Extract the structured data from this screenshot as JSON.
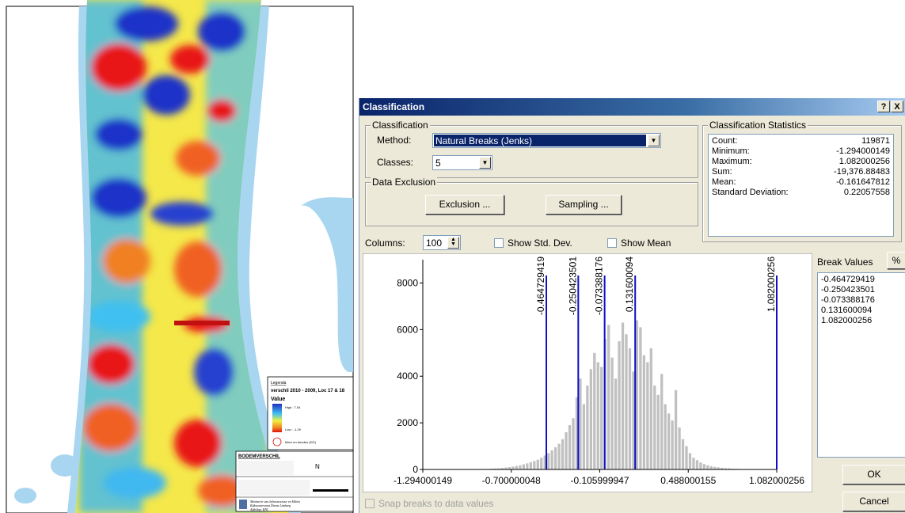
{
  "map": {
    "legend_title": "Legenda",
    "legend_layer": "verschil 2010 - 2009, Loc 17 & 18",
    "legend_value": "Value",
    "legend_high": "High : 7.04",
    "legend_low": "Low : -1.29",
    "legend_extra": "Meer en benden (DG)",
    "titleblock_heading": "BODEMVERSCHIL",
    "ministry": "Ministerie van Infrastructuur en Milieu",
    "ministry2": "Rijkswaterstaat Dienst Limburg",
    "ministry3": "Afdeling: RNI",
    "north": "N"
  },
  "dialog": {
    "title": "Classification",
    "help_btn": "?",
    "close_btn": "X",
    "classification_group": "Classification",
    "method_label": "Method:",
    "method_value": "Natural Breaks (Jenks)",
    "classes_label": "Classes:",
    "classes_value": "5",
    "exclusion_group": "Data Exclusion",
    "exclusion_btn": "Exclusion ...",
    "sampling_btn": "Sampling ...",
    "stats_group": "Classification Statistics",
    "stats": [
      {
        "label": "Count:",
        "value": "119871"
      },
      {
        "label": "Minimum:",
        "value": "-1.294000149"
      },
      {
        "label": "Maximum:",
        "value": "1.082000256"
      },
      {
        "label": "Sum:",
        "value": "-19,376.88483"
      },
      {
        "label": "Mean:",
        "value": "-0.161647812"
      },
      {
        "label": "Standard Deviation:",
        "value": "0.22057558"
      }
    ],
    "columns_label": "Columns:",
    "columns_value": "100",
    "show_std_dev": "Show Std. Dev.",
    "show_mean": "Show Mean",
    "break_values_label": "Break Values",
    "percent_btn": "%",
    "break_values": [
      "-0.464729419",
      "-0.250423501",
      "-0.073388176",
      "0.131600094",
      "1.082000256"
    ],
    "ok_btn": "OK",
    "cancel_btn": "Cancel",
    "snap_breaks": "Snap breaks to data values"
  },
  "chart_data": {
    "type": "bar",
    "x_ticks": [
      -1.294000149,
      -0.700000048,
      -0.105999947,
      0.488000155,
      1.082000256
    ],
    "x_tick_labels": [
      "-1.294000149",
      "-0.700000048",
      "-0.105999947",
      "0.488000155",
      "1.082000256"
    ],
    "y_ticks": [
      0,
      2000,
      4000,
      6000,
      8000
    ],
    "xlim": [
      -1.294000149,
      1.082000256
    ],
    "ylim": [
      0,
      9000
    ],
    "breaks": [
      -0.464729419,
      -0.250423501,
      -0.073388176,
      0.131600094,
      1.082000256
    ],
    "break_labels": [
      "-0.464729419",
      "-0.250423501",
      "-0.073388176",
      "0.131600094",
      "1.082000256"
    ],
    "bin_count": 100,
    "values": [
      0,
      0,
      0,
      0,
      0,
      0,
      0,
      0,
      0,
      0,
      0,
      0,
      0,
      0,
      0,
      5,
      10,
      15,
      20,
      30,
      40,
      50,
      60,
      80,
      100,
      120,
      150,
      180,
      220,
      260,
      310,
      360,
      420,
      500,
      600,
      700,
      820,
      950,
      1100,
      1300,
      1600,
      1900,
      2200,
      3100,
      3900,
      2800,
      3600,
      4300,
      5000,
      4600,
      4400,
      5600,
      6200,
      4800,
      3900,
      5500,
      6300,
      5800,
      5200,
      4200,
      6400,
      6100,
      4900,
      4600,
      5200,
      3600,
      3200,
      4100,
      2800,
      2400,
      2100,
      3400,
      1800,
      1300,
      1000,
      700,
      500,
      400,
      300,
      230,
      180,
      140,
      110,
      90,
      70,
      55,
      45,
      35,
      28,
      22,
      18,
      14,
      10,
      8,
      6,
      4,
      3,
      2,
      1,
      1
    ]
  }
}
